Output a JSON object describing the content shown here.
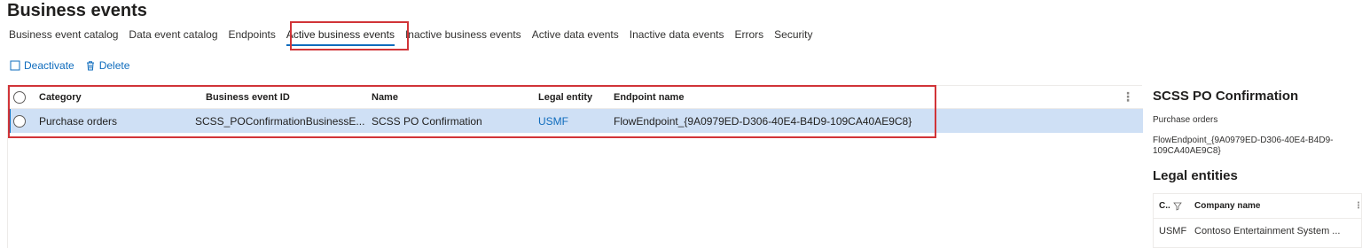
{
  "page": {
    "title": "Business events"
  },
  "tabs": [
    {
      "label": "Business event catalog"
    },
    {
      "label": "Data event catalog"
    },
    {
      "label": "Endpoints"
    },
    {
      "label": "Active business events",
      "active": true
    },
    {
      "label": "Inactive business events"
    },
    {
      "label": "Active data events"
    },
    {
      "label": "Inactive data events"
    },
    {
      "label": "Errors"
    },
    {
      "label": "Security"
    }
  ],
  "toolbar": {
    "deactivate_label": "Deactivate",
    "delete_label": "Delete"
  },
  "grid": {
    "columns": [
      "Category",
      "Business event ID",
      "Name",
      "Legal entity",
      "Endpoint name"
    ],
    "rows": [
      {
        "category": "Purchase orders",
        "business_event_id": "SCSS_POConfirmationBusinessE...",
        "name": "SCSS PO Confirmation",
        "legal_entity": "USMF",
        "endpoint_name": "FlowEndpoint_{9A0979ED-D306-40E4-B4D9-109CA40AE9C8}"
      }
    ]
  },
  "details": {
    "title": "SCSS PO Confirmation",
    "category": "Purchase orders",
    "endpoint": "FlowEndpoint_{9A0979ED-D306-40E4-B4D9-109CA40AE9C8}",
    "legal_entities_heading": "Legal entities",
    "le_columns": [
      "C..",
      "Company name"
    ],
    "le_rows": [
      {
        "code": "USMF",
        "company": "Contoso Entertainment System ..."
      }
    ]
  },
  "colors": {
    "accent": "#0f6cbd",
    "highlight_border": "#d13438",
    "selected_row": "#cfe0f5"
  }
}
